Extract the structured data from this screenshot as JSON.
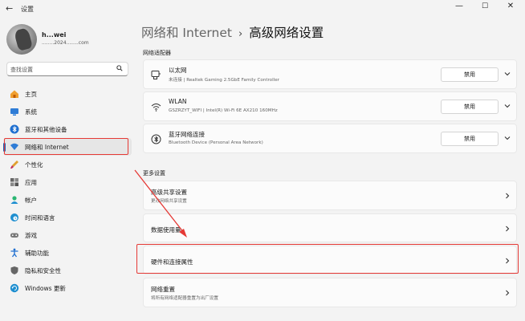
{
  "window": {
    "title": "设置",
    "back_glyph": "←",
    "minimize_glyph": "—",
    "maximize_glyph": "☐",
    "close_glyph": "✕"
  },
  "profile": {
    "name": "h...wei",
    "email": "........2024........com"
  },
  "search": {
    "placeholder": "查找设置"
  },
  "sidebar": {
    "items": [
      {
        "label": "主页",
        "icon": "home-icon"
      },
      {
        "label": "系统",
        "icon": "system-icon"
      },
      {
        "label": "蓝牙和其他设备",
        "icon": "bluetooth-icon"
      },
      {
        "label": "网络和 Internet",
        "icon": "network-icon",
        "selected": true
      },
      {
        "label": "个性化",
        "icon": "brush-icon"
      },
      {
        "label": "应用",
        "icon": "apps-icon"
      },
      {
        "label": "帐户",
        "icon": "account-icon"
      },
      {
        "label": "时间和语言",
        "icon": "globe-icon"
      },
      {
        "label": "游戏",
        "icon": "gamepad-icon"
      },
      {
        "label": "辅助功能",
        "icon": "accessibility-icon"
      },
      {
        "label": "隐私和安全性",
        "icon": "shield-icon"
      },
      {
        "label": "Windows 更新",
        "icon": "update-icon"
      }
    ]
  },
  "breadcrumb": {
    "parent": "网络和 Internet",
    "separator": "›",
    "current": "高级网络设置"
  },
  "adapters_section": {
    "label": "网络适配器",
    "items": [
      {
        "title": "以太网",
        "subtitle": "未连接 | Realtek Gaming 2.5GbE Family Controller",
        "button": "禁用",
        "icon": "ethernet-icon"
      },
      {
        "title": "WLAN",
        "subtitle": "GSZRZYT_WIFI | Intel(R) Wi-Fi 6E AX210 160MHz",
        "button": "禁用",
        "icon": "wifi-icon"
      },
      {
        "title": "蓝牙网络连接",
        "subtitle": "Bluetooth Device (Personal Area Network)",
        "button": "禁用",
        "icon": "bluetooth-network-icon"
      }
    ]
  },
  "more_section": {
    "label": "更多设置",
    "items": [
      {
        "title": "高级共享设置",
        "subtitle": "更改网络共享设置"
      },
      {
        "title": "数据使用量",
        "subtitle": ""
      },
      {
        "title": "硬件和连接属性",
        "subtitle": ""
      },
      {
        "title": "网络重置",
        "subtitle": "将所有网络适配器重置为出厂设置"
      }
    ]
  },
  "colors": {
    "accent": "#1a5fb4",
    "annotation": "#e53935"
  }
}
